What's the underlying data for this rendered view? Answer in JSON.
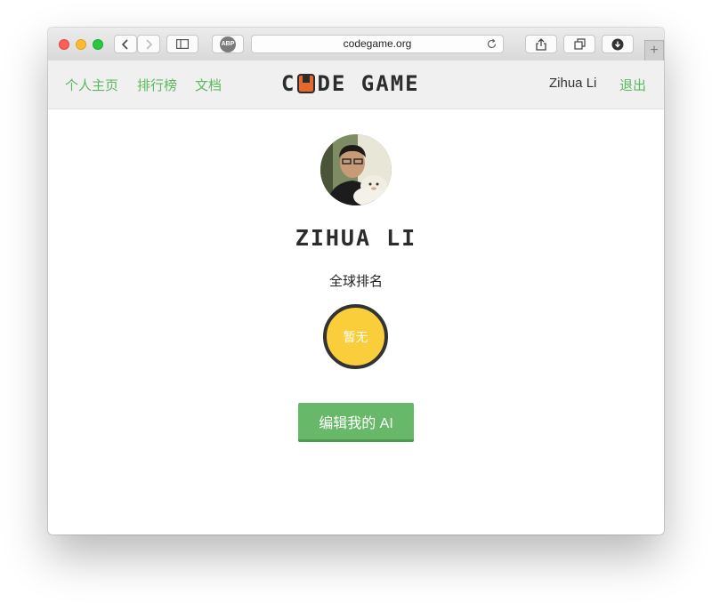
{
  "browser": {
    "url": "codegame.org",
    "extension_label": "ABP",
    "new_tab_label": "+"
  },
  "nav": {
    "home": "个人主页",
    "leaderboard": "排行榜",
    "docs": "文档",
    "logo_left": "C",
    "logo_right": "DE GAME",
    "user_name": "Zihua Li",
    "logout": "退出"
  },
  "profile": {
    "name": "ZIHUA LI",
    "rank_label": "全球排名",
    "rank_value": "暂无",
    "edit_button": "编辑我的 AI"
  },
  "colors": {
    "accent_green": "#5cb85c",
    "button_green": "#67b868",
    "rank_yellow": "#f9ce3a",
    "logo_orange": "#e36a2c"
  }
}
